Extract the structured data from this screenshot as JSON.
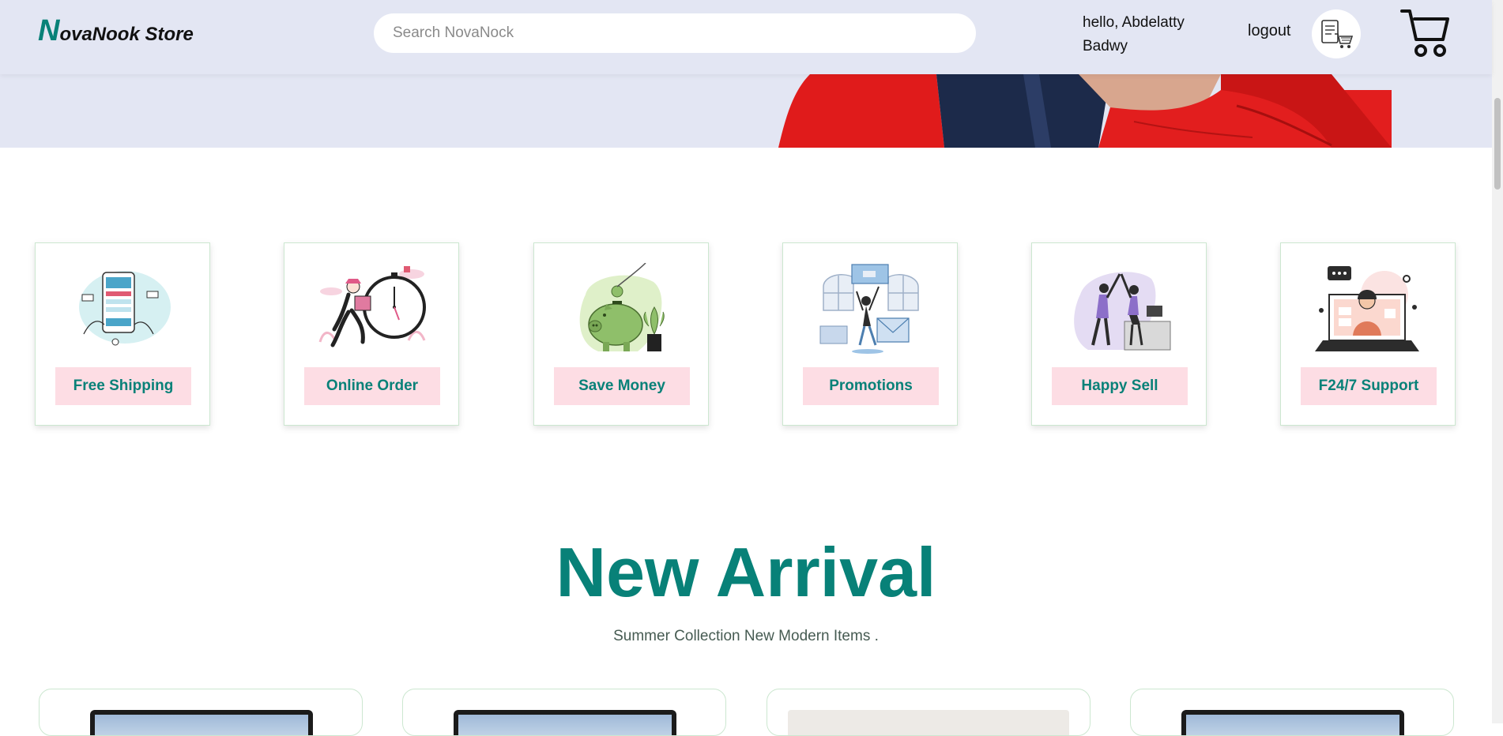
{
  "header": {
    "logo_initial": "N",
    "logo_rest": "ovaNook Store",
    "search_placeholder": "Search NovaNock",
    "greeting_line1": "hello, Abdelatty",
    "greeting_line2": "Badwy",
    "logout_label": "logout",
    "order_icon": "order-list-icon",
    "cart_icon": "shopping-cart-icon"
  },
  "features": [
    {
      "label": "Free Shipping",
      "icon": "mobile-payment-illustration"
    },
    {
      "label": "Online Order",
      "icon": "fast-delivery-illustration"
    },
    {
      "label": "Save Money",
      "icon": "piggy-bank-illustration"
    },
    {
      "label": "Promotions",
      "icon": "promotion-illustration"
    },
    {
      "label": "Happy Sell",
      "icon": "high-five-illustration"
    },
    {
      "label": "F24/7 Support",
      "icon": "support-agent-illustration"
    }
  ],
  "new_arrival": {
    "title": "New Arrival",
    "subtitle": "Summer Collection New Modern Items ."
  },
  "colors": {
    "accent": "#088178",
    "header_bg": "#e3e6f3",
    "feature_label_bg": "#fddde4"
  }
}
